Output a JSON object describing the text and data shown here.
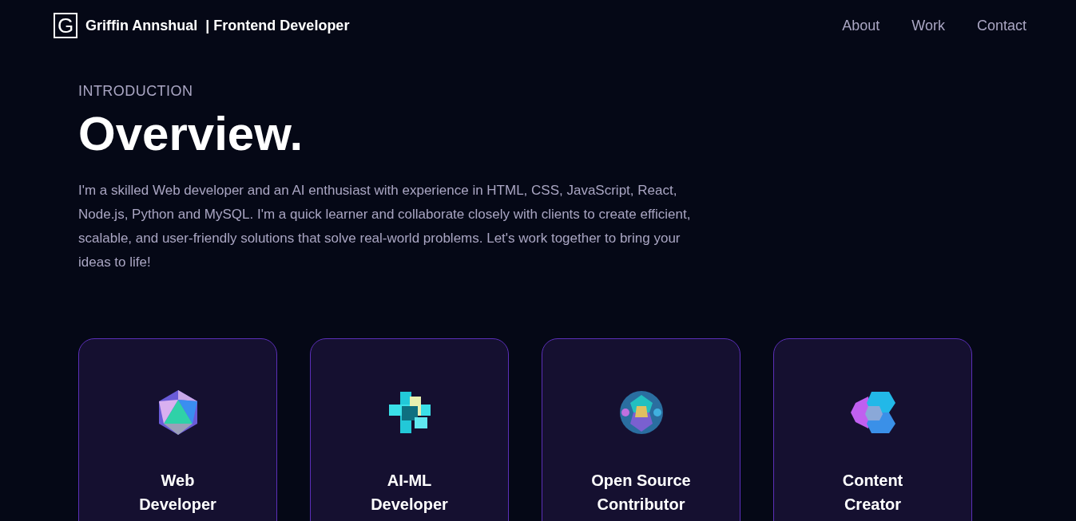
{
  "navbar": {
    "logo_letter": "G",
    "brand": "Griffin Annshual",
    "role": "| Frontend Developer",
    "links": [
      "About",
      "Work",
      "Contact"
    ]
  },
  "section": {
    "subtitle": "INTRODUCTION",
    "title": "Overview.",
    "paragraph": "I'm a skilled Web developer and an AI enthusiast with experience in HTML, CSS, JavaScript, React, Node.js, Python and MySQL. I'm a quick learner and collaborate closely with clients to create efficient, scalable, and user-friendly solutions that solve real-world problems. Let's work together to bring your ideas to life!"
  },
  "cards": [
    {
      "title": "Web Developer",
      "kind": "icosahedron"
    },
    {
      "title": "AI-ML Developer",
      "kind": "cubes"
    },
    {
      "title": "Open Source Contributor",
      "kind": "sphere"
    },
    {
      "title": "Content Creator",
      "kind": "hexagons"
    }
  ]
}
